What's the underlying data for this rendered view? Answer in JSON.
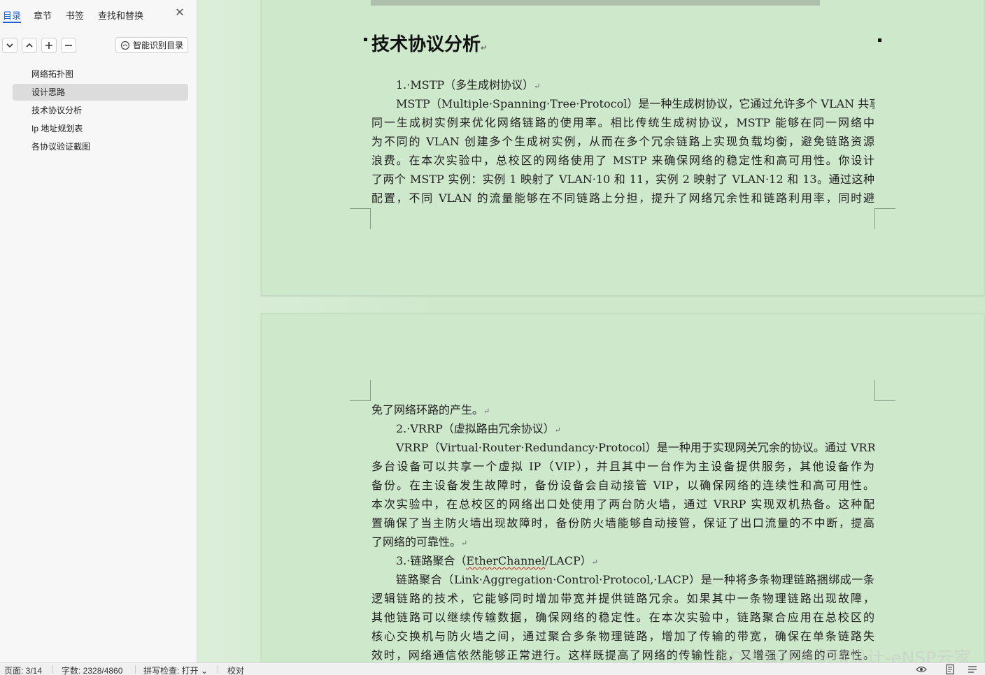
{
  "sidebar": {
    "tabs": [
      "目录",
      "章节",
      "书签",
      "查找和替换"
    ],
    "smart_button": "智能识别目录",
    "toc": [
      "网络拓扑图",
      "设计思路",
      "技术协议分析",
      "Ip 地址规划表",
      "各协议验证截图"
    ]
  },
  "page1": {
    "heading": "技术协议分析",
    "mstp_title": "1.·MSTP（多生成树协议）",
    "mstp_lines": [
      "MSTP（Multiple·Spanning·Tree·Protocol）是一种生成树协议，它通过允许多个 VLAN 共享",
      "同一生成树实例来优化网络链路的使用率。相比传统生成树协议，MSTP 能够在同一网络中",
      "为不同的 VLAN 创建多个生成树实例，从而在多个冗余链路上实现负载均衡，避免链路资源",
      "浪费。在本次实验中，总校区的网络使用了 MSTP 来确保网络的稳定性和高可用性。你设计",
      "了两个 MSTP 实例：实例 1 映射了 VLAN·10 和 11，实例 2 映射了 VLAN·12 和 13。通过这种",
      "配置，不同 VLAN 的流量能够在不同链路上分担，提升了网络冗余性和链路利用率，同时避"
    ]
  },
  "page2": {
    "mstp_tail": "免了网络环路的产生。",
    "vrrp_title": "2.·VRRP（虚拟路由冗余协议）",
    "vrrp_lines": [
      "VRRP（Virtual·Router·Redundancy·Protocol）是一种用于实现网关冗余的协议。通过 VRRP，",
      "多台设备可以共享一个虚拟 IP（VIP），并且其中一台作为主设备提供服务，其他设备作为",
      "备份。在主设备发生故障时，备份设备会自动接管 VIP，以确保网络的连续性和高可用性。",
      "本次实验中，在总校区的网络出口处使用了两台防火墙，通过 VRRP 实现双机热备。这种配",
      "置确保了当主防火墙出现故障时，备份防火墙能够自动接管，保证了出口流量的不中断，提高"
    ],
    "vrrp_tail": "了网络的可靠性。",
    "lacp_title_prefix": "3.·链路聚合（",
    "lacp_title_word": "EtherChannel",
    "lacp_title_suffix": "/LACP）",
    "lacp_lines": [
      "链路聚合（Link·Aggregation·Control·Protocol,·LACP）是一种将多条物理链路捆绑成一条",
      "逻辑链路的技术，它能够同时增加带宽并提供链路冗余。如果其中一条物理链路出现故障，",
      "其他链路可以继续传输数据，确保网络的稳定性。在本次实验中，链路聚合应用在总校区的",
      "核心交换机与防火墙之间，通过聚合多条物理链路，增加了传输的带宽，确保在单条链路失",
      "效时，网络通信依然能够正常进行。这样既提高了网络的传输性能，又增强了网络的可靠性。"
    ]
  },
  "para_mark": "↵",
  "statusbar": {
    "page": "页面: 3/14",
    "words": "字数: 2328/4860",
    "spell": "拼写检查: 打开",
    "proof": "校对"
  },
  "watermark": "CSDN @华为网络设计-eNSP云家"
}
